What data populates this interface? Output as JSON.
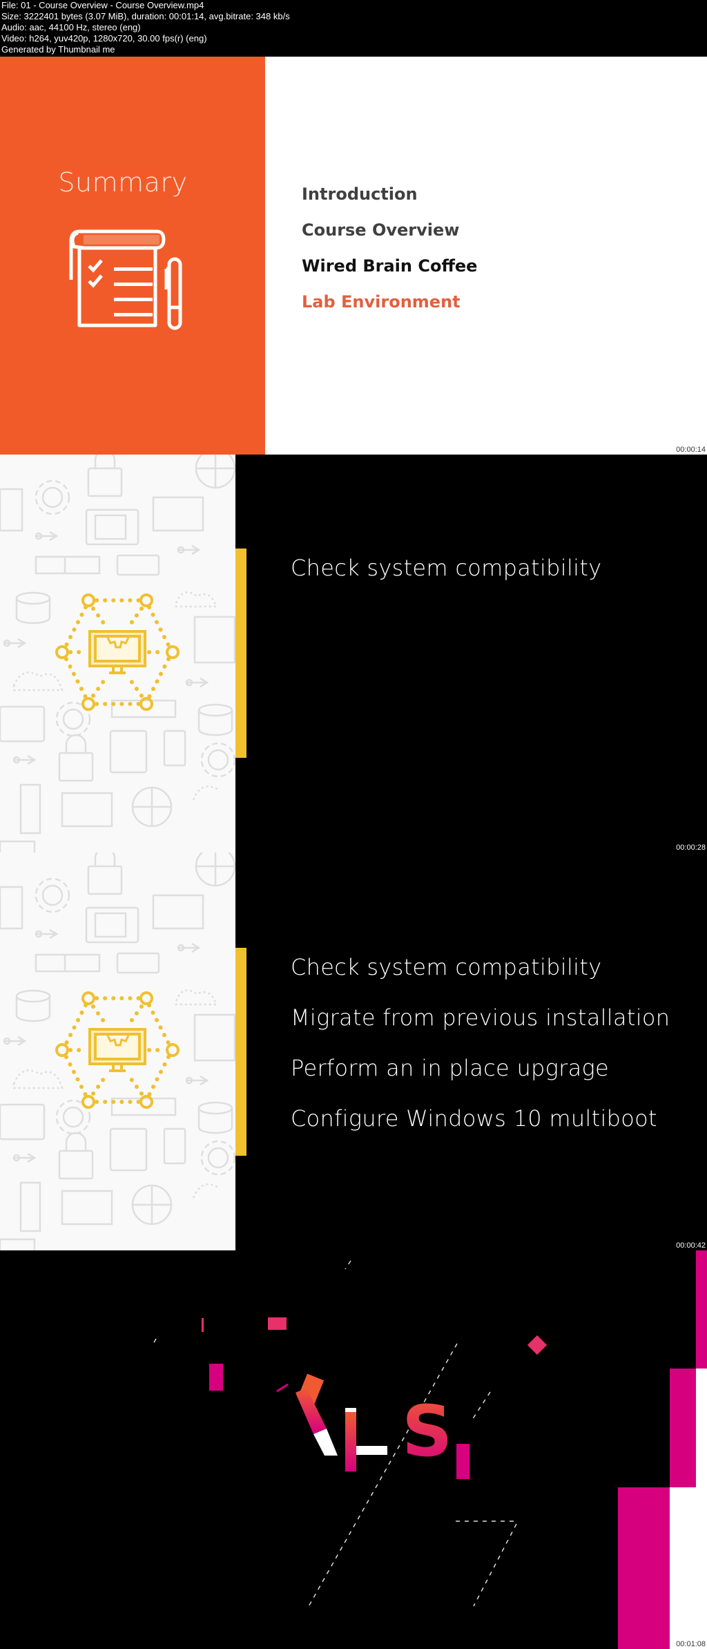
{
  "header": {
    "lines": [
      "File: 01 - Course Overview - Course Overview.mp4",
      "Size: 3222401 bytes (3.07 MiB), duration: 00:01:14, avg.bitrate: 348 kb/s",
      "Audio: aac, 44100 Hz, stereo (eng)",
      "Video: h264, yuv420p, 1280x720, 30.00 fps(r) (eng)",
      "Generated by Thumbnail me"
    ]
  },
  "frames": [
    {
      "timestamp": "00:00:14",
      "summary_title": "Summary",
      "icon": "checklist-notepad-pen-icon",
      "agenda": [
        {
          "label": "Introduction",
          "color": "#404040"
        },
        {
          "label": "Course Overview",
          "color": "#404040"
        },
        {
          "label": "Wired Brain Coffee",
          "color": "#111111"
        },
        {
          "label": "Lab Environment",
          "color": "#e2603f"
        }
      ]
    },
    {
      "timestamp": "00:00:28",
      "icon": "monitor-gear-network-icon",
      "bullets": [
        "Check system compatibility"
      ]
    },
    {
      "timestamp": "00:00:42",
      "icon": "monitor-gear-network-icon",
      "bullets": [
        "Check system compatibility",
        "Migrate from previous installation",
        "Perform an in place upgrage",
        "Configure Windows 10 multiboot"
      ]
    },
    {
      "timestamp": "00:01:08",
      "logo_fragment": "LS",
      "logo": "pluralsight-animated-logo"
    }
  ],
  "colors": {
    "orange": "#f15b2a",
    "yellow": "#f0c02f",
    "magenta": "#d6007f",
    "pink_red": "#e83d5a"
  }
}
